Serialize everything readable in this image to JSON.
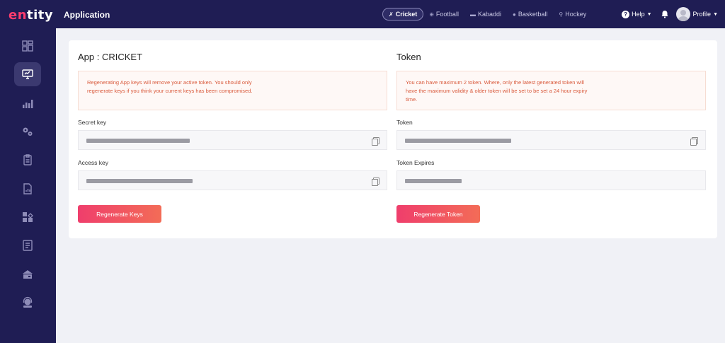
{
  "brand": {
    "logo_text_a": "en",
    "logo_text_b": "tity"
  },
  "sidebar": {
    "items": [
      {
        "name": "dashboard",
        "icon": "dashboard-icon"
      },
      {
        "name": "application",
        "icon": "monitor-icon",
        "active": true
      },
      {
        "name": "analytics",
        "icon": "bar-chart-icon"
      },
      {
        "name": "settings",
        "icon": "gears-icon"
      },
      {
        "name": "reports",
        "icon": "clipboard-icon"
      },
      {
        "name": "documents",
        "icon": "document-chart-icon"
      },
      {
        "name": "widgets",
        "icon": "widgets-icon"
      },
      {
        "name": "logs",
        "icon": "notes-icon"
      },
      {
        "name": "billing",
        "icon": "wallet-icon"
      },
      {
        "name": "support",
        "icon": "headset-icon"
      }
    ]
  },
  "header": {
    "title": "Application",
    "tabs": [
      {
        "label": "Cricket",
        "icon": "cricket-icon",
        "active": true
      },
      {
        "label": "Football",
        "icon": "football-icon"
      },
      {
        "label": "Kabaddi",
        "icon": "kabaddi-icon"
      },
      {
        "label": "Basketball",
        "icon": "basketball-icon"
      },
      {
        "label": "Hockey",
        "icon": "hockey-icon"
      }
    ],
    "help_label": "Help",
    "profile_label": "Profile"
  },
  "app": {
    "title": "App : CRICKET",
    "alert": "Regenerating App keys will remove your active token. You should only regenerate keys if you think your current keys has been compromised.",
    "secret_key_label": "Secret key",
    "access_key_label": "Access key",
    "regenerate_label": "Regenerate Keys"
  },
  "token": {
    "title": "Token",
    "alert": "You can have maximum 2 token. Where, only the latest generated token will have the maximum validity & older token will be set to be set a 24 hour expiry time.",
    "token_label": "Token",
    "expires_label": "Token Expires",
    "regenerate_label": "Regenerate Token"
  },
  "colors": {
    "sidebar_bg": "#1f1d54",
    "accent_start": "#ef3e6c",
    "accent_end": "#f36c57",
    "alert_text": "#d95a3c"
  }
}
